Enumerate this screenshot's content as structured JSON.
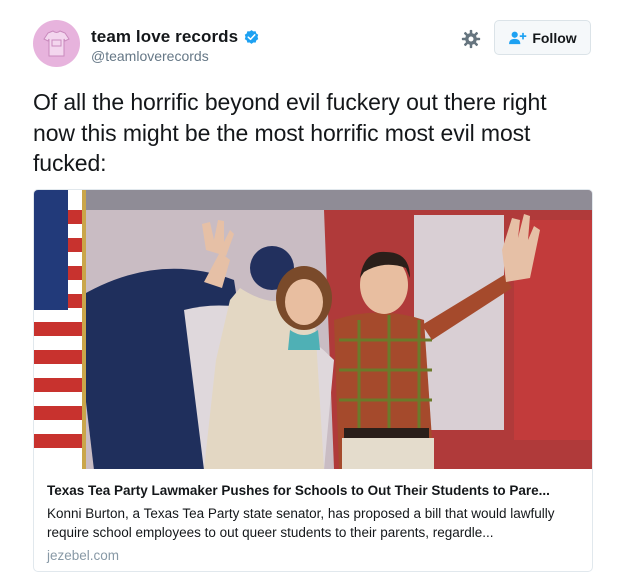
{
  "header": {
    "display_name": "team love records",
    "handle": "@teamloverecords",
    "follow_label": "Follow"
  },
  "icons": {
    "verified": "verified-badge-icon",
    "settings": "gear-icon",
    "follow": "add-user-icon"
  },
  "colors": {
    "verified_blue": "#1da1f2",
    "avatar_pink": "#e7b3dd",
    "link_grey": "#8899a6"
  },
  "tweet": {
    "text": "Of all the horrific beyond evil fuckery out there right now this might be the most horrific most evil most fucked:"
  },
  "card": {
    "image_alt": "",
    "title": "Texas Tea Party Lawmaker Pushes for Schools to Out Their Students to Pare...",
    "description": "Konni Burton, a Texas Tea Party state senator, has proposed a bill that would lawfully require school employees to out queer students to their parents, regardle...",
    "domain": "jezebel.com"
  }
}
